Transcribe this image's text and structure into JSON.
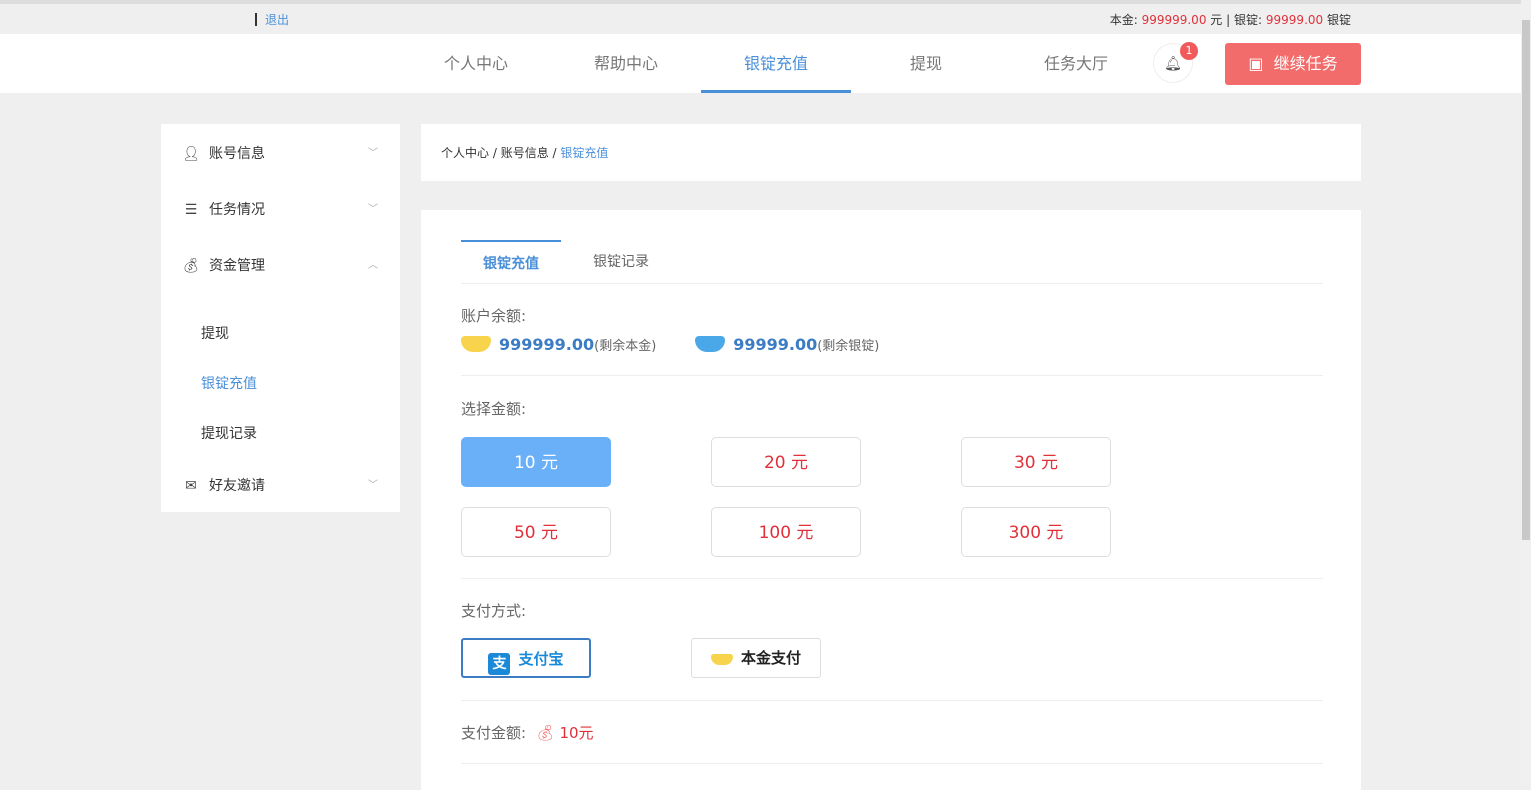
{
  "topbar": {
    "logout": "退出",
    "principal_label": "本金:",
    "principal_value": "999999.00",
    "principal_unit": "元",
    "sep": "|",
    "ingot_label": "银锭:",
    "ingot_value": "99999.00",
    "ingot_unit": "银锭"
  },
  "nav": {
    "items": [
      "个人中心",
      "帮助中心",
      "银锭充值",
      "提现",
      "任务大厅"
    ],
    "badge": "1",
    "continue": "继续任务"
  },
  "sidebar": {
    "groups": [
      "账号信息",
      "任务情况",
      "资金管理",
      "好友邀请"
    ],
    "subs": [
      "提现",
      "银锭充值",
      "提现记录"
    ]
  },
  "breadcrumb": {
    "a": "个人中心",
    "b": "账号信息",
    "c": "银锭充值",
    "sep": " / "
  },
  "main": {
    "tabs": [
      "银锭充值",
      "银锭记录"
    ],
    "balance_label": "账户余额:",
    "principal": "999999.00",
    "principal_note": "(剩余本金)",
    "ingot": "99999.00",
    "ingot_note": "(剩余银锭)",
    "choose_label": "选择金额:",
    "options": [
      "10 元",
      "20 元",
      "30 元",
      "50 元",
      "100 元",
      "300 元"
    ],
    "pay_label": "支付方式:",
    "pay_methods": [
      "支付宝",
      "本金支付"
    ],
    "amount_label": "支付金额:",
    "amount": "10元"
  },
  "colors": {
    "accent": "#4a90d9",
    "red": "#e0303a",
    "button": "#f26c6c"
  }
}
